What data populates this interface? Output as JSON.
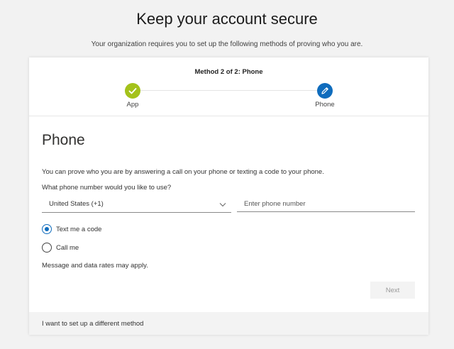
{
  "header": {
    "title": "Keep your account secure",
    "subtitle": "Your organization requires you to set up the following methods of proving who you are."
  },
  "stepper": {
    "heading": "Method 2 of 2: Phone",
    "steps": [
      {
        "label": "App",
        "status": "completed",
        "icon": "checkmark-icon",
        "color": "#a4c21b"
      },
      {
        "label": "Phone",
        "status": "current",
        "icon": "pencil-icon",
        "color": "#0f6cbd"
      }
    ]
  },
  "section": {
    "title": "Phone",
    "description": "You can prove who you are by answering a call on your phone or texting a code to your phone.",
    "question": "What phone number would you like to use?",
    "country_select": {
      "value": "United States (+1)",
      "icon": "chevron-down-icon"
    },
    "phone_input": {
      "placeholder": "Enter phone number",
      "value": ""
    },
    "options": [
      {
        "label": "Text me a code",
        "selected": true
      },
      {
        "label": "Call me",
        "selected": false
      }
    ],
    "note": "Message and data rates may apply.",
    "next_button": "Next"
  },
  "footer": {
    "link": "I want to set up a different method"
  },
  "colors": {
    "accent": "#0f6cbd",
    "success": "#a4c21b",
    "background": "#f2f2f2"
  }
}
